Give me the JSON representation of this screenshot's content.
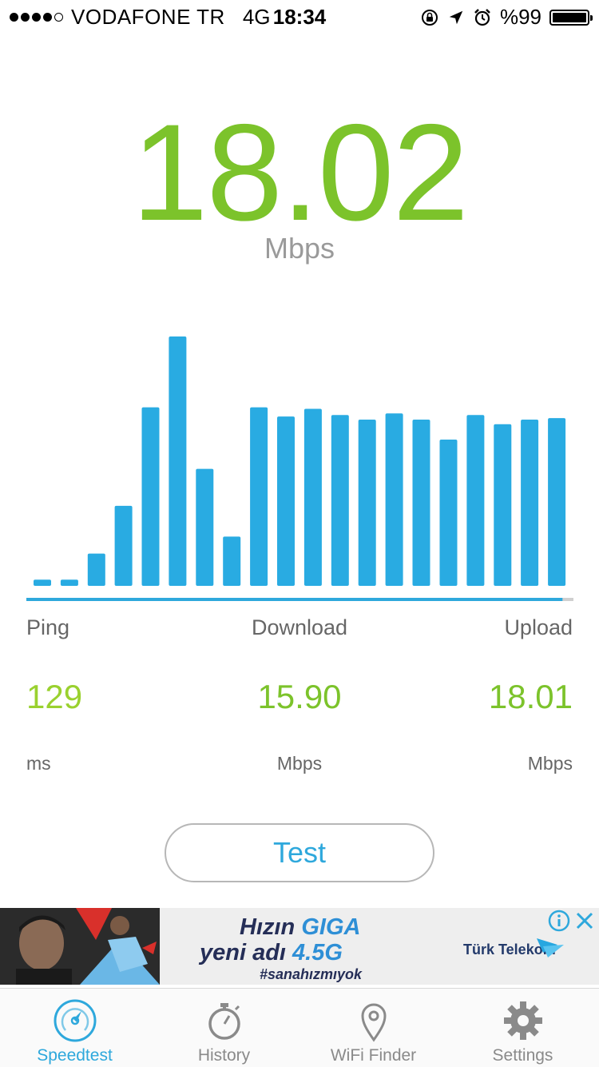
{
  "status_bar": {
    "carrier": "VODAFONE TR",
    "network": "4G",
    "time": "18:34",
    "battery": "%99",
    "signal_bars_filled": 4,
    "signal_bars_total": 5,
    "icons": [
      "rotation-lock-icon",
      "location-arrow-icon",
      "alarm-clock-icon",
      "battery-icon"
    ]
  },
  "speed": {
    "value": "18.02",
    "unit": "Mbps",
    "color": "#7cc32b"
  },
  "chart_data": {
    "type": "bar",
    "values": [
      0.4,
      0.4,
      2.1,
      5.2,
      11.6,
      16.2,
      7.6,
      3.2,
      11.6,
      11.0,
      11.5,
      11.1,
      10.8,
      11.2,
      10.8,
      9.5,
      11.1,
      10.5,
      10.8,
      10.9
    ],
    "color": "#29abe2",
    "progress": 0.98
  },
  "stats": {
    "ping": {
      "label": "Ping",
      "value": "129",
      "unit": "ms"
    },
    "download": {
      "label": "Download",
      "value": "15.90",
      "unit": "Mbps"
    },
    "upload": {
      "label": "Upload",
      "value": "18.01",
      "unit": "Mbps"
    }
  },
  "test_button": {
    "label": "Test"
  },
  "ad": {
    "line1a": "Hızın ",
    "line1b": "GIGA",
    "line2a": "yeni adı ",
    "line2b": "4.5G",
    "line3": "#sanahızmıyok",
    "brand": "Türk Telekom"
  },
  "tabs": [
    {
      "label": "Speedtest",
      "icon": "speedometer-icon",
      "active": true
    },
    {
      "label": "History",
      "icon": "stopwatch-icon",
      "active": false
    },
    {
      "label": "WiFi Finder",
      "icon": "location-pin-icon",
      "active": false
    },
    {
      "label": "Settings",
      "icon": "gear-icon",
      "active": false
    }
  ],
  "colors": {
    "accent": "#2ea8dc",
    "green": "#7cc32b",
    "bar": "#29abe2"
  }
}
